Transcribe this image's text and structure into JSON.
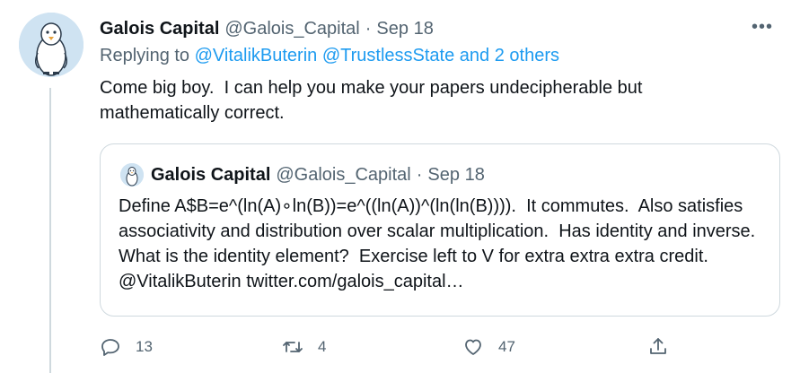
{
  "tweet": {
    "author_name": "Galois Capital",
    "author_handle": "@Galois_Capital",
    "separator": "·",
    "date": "Sep 18",
    "more_label": "•••",
    "replying_prefix": "Replying to",
    "replying_mentions": "@VitalikButerin @TrustlessState and 2 others",
    "text": "Come big boy.  I can help you make your papers undecipherable but mathematically correct."
  },
  "quote": {
    "author_name": "Galois Capital",
    "author_handle": "@Galois_Capital",
    "separator": "·",
    "date": "Sep 18",
    "text": "Define A$B=e^(ln(A)∘ln(B))=e^((ln(A))^(ln(ln(B)))).  It commutes.  Also satisfies associativity and distribution over scalar multiplication.  Has identity and inverse.  What is the identity element?  Exercise left to V for extra extra extra credit. @VitalikButerin twitter.com/galois_capital…"
  },
  "actions": {
    "reply_count": "13",
    "retweet_count": "4",
    "like_count": "47"
  },
  "icons": {
    "reply": "reply-icon",
    "retweet": "retweet-icon",
    "like": "heart-icon",
    "share": "share-icon",
    "more": "more-icon"
  },
  "colors": {
    "link": "#1d9bf0",
    "secondary_text": "#536471",
    "border": "#cfd9de"
  }
}
